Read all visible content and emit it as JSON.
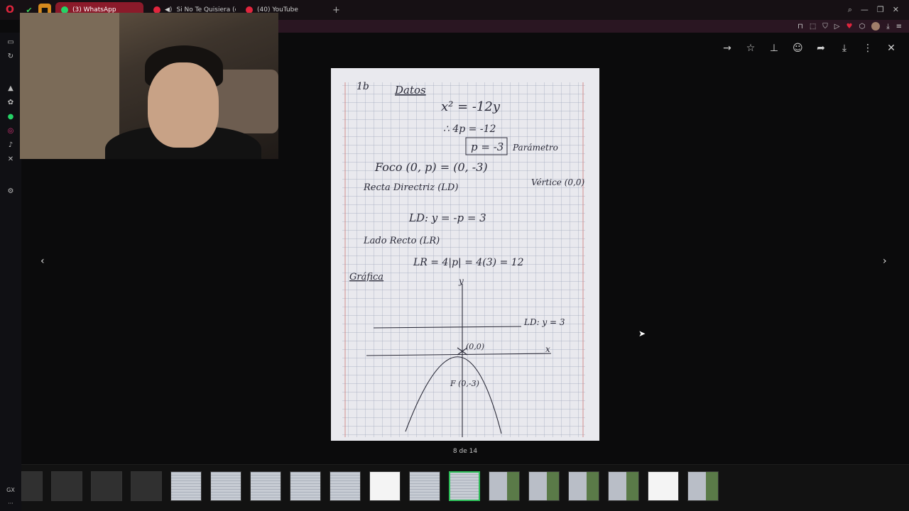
{
  "browser": {
    "tabs": [
      {
        "label": "(3) WhatsApp",
        "icon": "whatsapp-icon",
        "active": true,
        "color": "#25d366"
      },
      {
        "label": "Si No Te Quisiera (co",
        "icon": "youtube-icon",
        "active": false,
        "color": "#e0253d"
      },
      {
        "label": "(40) YouTube",
        "icon": "youtube-icon",
        "active": false,
        "color": "#e0253d"
      }
    ],
    "new_tab": "+"
  },
  "viewer": {
    "counter": "8 de 14",
    "prev_glyph": "‹",
    "next_glyph": "›",
    "toolbar": [
      "forward-icon",
      "star-icon",
      "pin-icon",
      "emoji-icon",
      "share-icon",
      "download-icon",
      "more-icon",
      "close-icon"
    ]
  },
  "note": {
    "title": "1b",
    "datos": "Datos",
    "equation": "x² = -12y",
    "step": "∴ 4p = -12",
    "p_value": "p = -3",
    "parametro": "Parámetro",
    "foco": "Foco (0, p) = (0, -3)",
    "vertice": "Vértice (0,0)",
    "directriz_label": "Recta Directriz (LD)",
    "directriz": "LD: y = -p = 3",
    "lado_recto_label": "Lado Recto (LR)",
    "lado_recto": "LR = 4|p| = 4(3) = 12",
    "grafica": "Gráfica",
    "axis_y": "y",
    "axis_x": "x",
    "ld_graph": "LD: y = 3",
    "origin": "(0,0)",
    "focus_graph": "F (0,-3)"
  },
  "thumbnails": {
    "count": 18,
    "selected_index": 11
  },
  "sidebar": {
    "bottom_label": "GX"
  }
}
